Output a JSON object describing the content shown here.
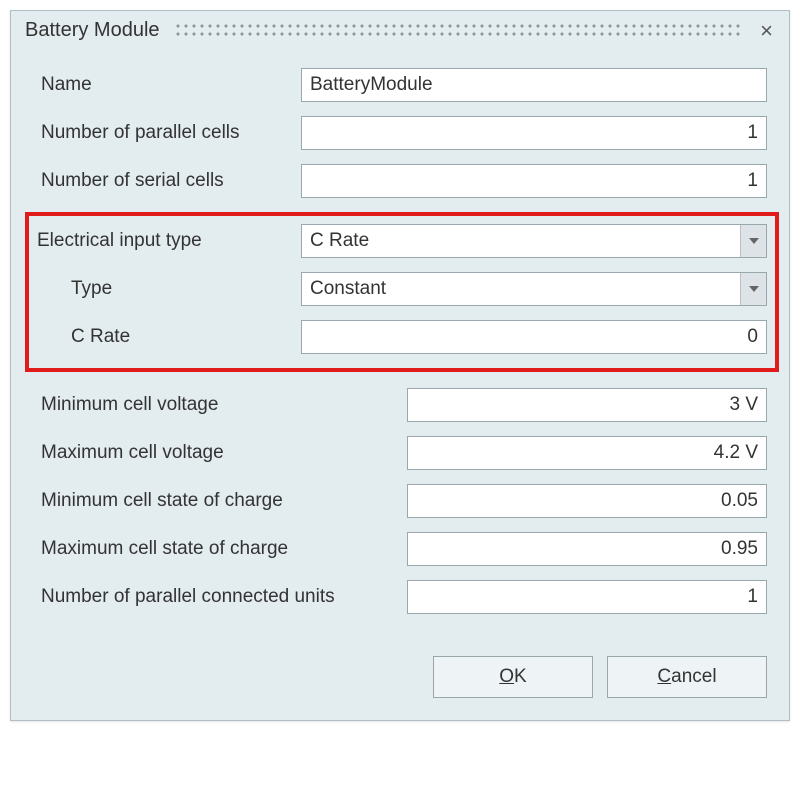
{
  "titlebar": {
    "title": "Battery Module"
  },
  "fields": {
    "name": {
      "label": "Name",
      "value": "BatteryModule"
    },
    "parallel_cells": {
      "label": "Number of parallel cells",
      "value": "1"
    },
    "serial_cells": {
      "label": "Number of serial cells",
      "value": "1"
    },
    "electrical_input_type": {
      "label": "Electrical input type",
      "value": "C Rate"
    },
    "sub_type": {
      "label": "Type",
      "value": "Constant"
    },
    "c_rate": {
      "label": "C Rate",
      "value": "0"
    },
    "min_voltage": {
      "label": "Minimum cell voltage",
      "value": "3 V"
    },
    "max_voltage": {
      "label": "Maximum cell voltage",
      "value": "4.2 V"
    },
    "min_soc": {
      "label": "Minimum cell state of charge",
      "value": "0.05"
    },
    "max_soc": {
      "label": "Maximum cell state of charge",
      "value": "0.95"
    },
    "parallel_units": {
      "label": "Number of parallel connected units",
      "value": "1"
    }
  },
  "buttons": {
    "ok_prefix": "O",
    "ok_suffix": "K",
    "cancel_prefix": "C",
    "cancel_suffix": "ancel"
  }
}
